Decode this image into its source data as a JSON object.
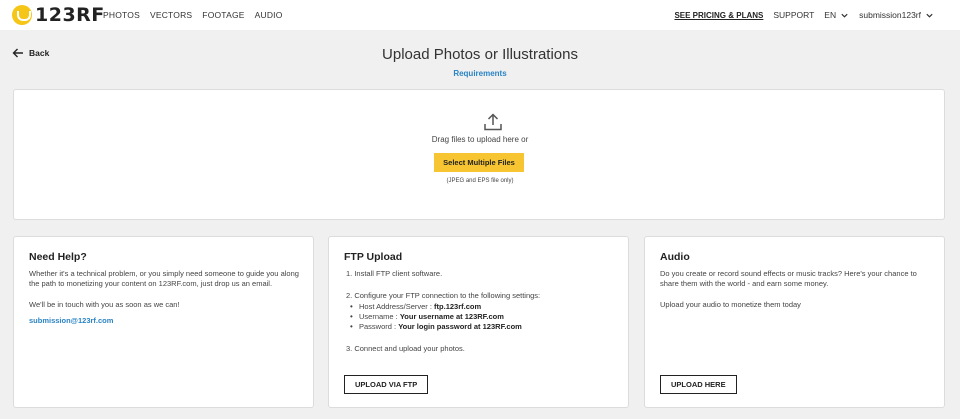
{
  "header": {
    "logo_text": "123RF",
    "nav": [
      "PHOTOS",
      "VECTORS",
      "FOOTAGE",
      "AUDIO"
    ],
    "pricing": "SEE PRICING & PLANS",
    "support": "SUPPORT",
    "language": "EN",
    "username": "submission123rf"
  },
  "page": {
    "back_label": "Back",
    "title": "Upload Photos or Illustrations",
    "requirements": "Requirements"
  },
  "dropzone": {
    "drag_text": "Drag files to upload here or",
    "button": "Select Multiple Files",
    "note": "(JPEG and EPS file only)"
  },
  "help": {
    "title": "Need Help?",
    "para1": "Whether it's a technical problem, or you simply need someone to guide you along the path to monetizing your content on 123RF.com, just drop us an email.",
    "para2": "We'll be in touch with you as soon as we can!",
    "email": "submission@123rf.com"
  },
  "ftp": {
    "title": "FTP Upload",
    "step1": "1.  Install FTP client software.",
    "step2": "2.  Configure your FTP connection to the following settings:",
    "host_label": "Host Address/Server : ",
    "host_value": "ftp.123rf.com",
    "user_label": "Username : ",
    "user_value": "Your username at 123RF.com",
    "pass_label": "Password : ",
    "pass_value": "Your login password at 123RF.com",
    "step3": "3.  Connect and upload your photos.",
    "button": "UPLOAD VIA FTP"
  },
  "audio": {
    "title": "Audio",
    "para1": "Do you create or record sound effects or music tracks? Here's your chance to share them with the world - and earn some money.",
    "para2": "Upload your audio to monetize them today",
    "button": "UPLOAD HERE"
  },
  "colors": {
    "accent_yellow": "#f7c531",
    "link_blue": "#2a83c4",
    "background": "#f0f0f0"
  }
}
